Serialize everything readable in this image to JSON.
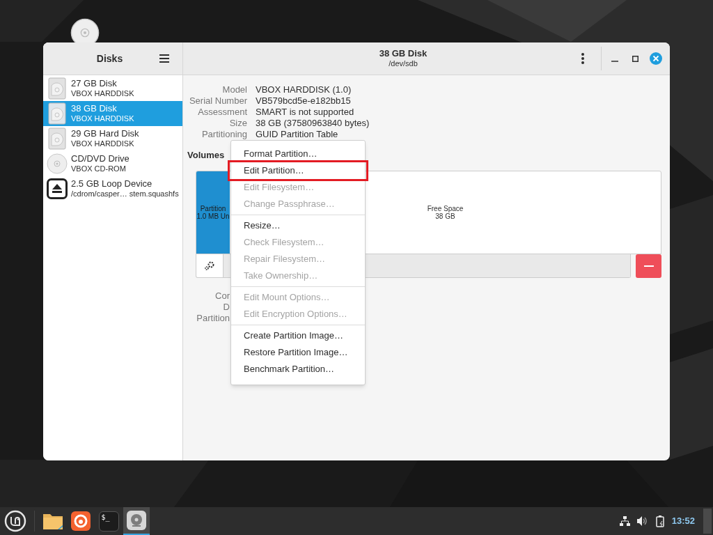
{
  "window": {
    "sidebar_title": "Disks",
    "title": "38 GB Disk",
    "subtitle": "/dev/sdb"
  },
  "drives": [
    {
      "kind": "disk",
      "name": "27 GB Disk",
      "detail": "VBOX HARDDISK",
      "selected": false
    },
    {
      "kind": "disk",
      "name": "38 GB Disk",
      "detail": "VBOX HARDDISK",
      "selected": true
    },
    {
      "kind": "disk",
      "name": "29 GB Hard Disk",
      "detail": "VBOX HARDDISK",
      "selected": false
    },
    {
      "kind": "optical",
      "name": "CD/DVD Drive",
      "detail": "VBOX CD-ROM",
      "selected": false
    },
    {
      "kind": "loop",
      "name": "2.5 GB Loop Device",
      "detail": "/cdrom/casper… stem.squashfs",
      "selected": false
    }
  ],
  "properties": [
    {
      "label": "Model",
      "value": "VBOX HARDDISK (1.0)"
    },
    {
      "label": "Serial Number",
      "value": "VB579bcd5e-e182bb15"
    },
    {
      "label": "Assessment",
      "value": "SMART is not supported"
    },
    {
      "label": "Size",
      "value": "38 GB (37580963840 bytes)"
    },
    {
      "label": "Partitioning",
      "value": "GUID Partition Table"
    }
  ],
  "volumes": {
    "heading": "Volumes",
    "segments": [
      {
        "kind": "partition",
        "name": "Partition",
        "size": "1.0 MB Un",
        "selected": true
      },
      {
        "kind": "free",
        "name": "Free Space",
        "size": "38 GB",
        "selected": false
      }
    ],
    "partition_labels": [
      "Cor",
      "D",
      "Partition"
    ]
  },
  "menu": {
    "sections": [
      [
        {
          "label": "Format Partition…",
          "disabled": false
        },
        {
          "label": "Edit Partition…",
          "disabled": false,
          "highlighted": true
        },
        {
          "label": "Edit Filesystem…",
          "disabled": true
        },
        {
          "label": "Change Passphrase…",
          "disabled": true
        }
      ],
      [
        {
          "label": "Resize…",
          "disabled": false
        },
        {
          "label": "Check Filesystem…",
          "disabled": true
        },
        {
          "label": "Repair Filesystem…",
          "disabled": true
        },
        {
          "label": "Take Ownership…",
          "disabled": true
        }
      ],
      [
        {
          "label": "Edit Mount Options…",
          "disabled": true
        },
        {
          "label": "Edit Encryption Options…",
          "disabled": true
        }
      ],
      [
        {
          "label": "Create Partition Image…",
          "disabled": false
        },
        {
          "label": "Restore Partition Image…",
          "disabled": false
        },
        {
          "label": "Benchmark Partition…",
          "disabled": false
        }
      ]
    ]
  },
  "taskbar": {
    "apps": [
      {
        "kind": "files",
        "active": false
      },
      {
        "kind": "browser",
        "active": false
      },
      {
        "kind": "terminal",
        "label": "$_",
        "active": false
      },
      {
        "kind": "disks",
        "active": true
      }
    ],
    "clock": "13:52"
  }
}
